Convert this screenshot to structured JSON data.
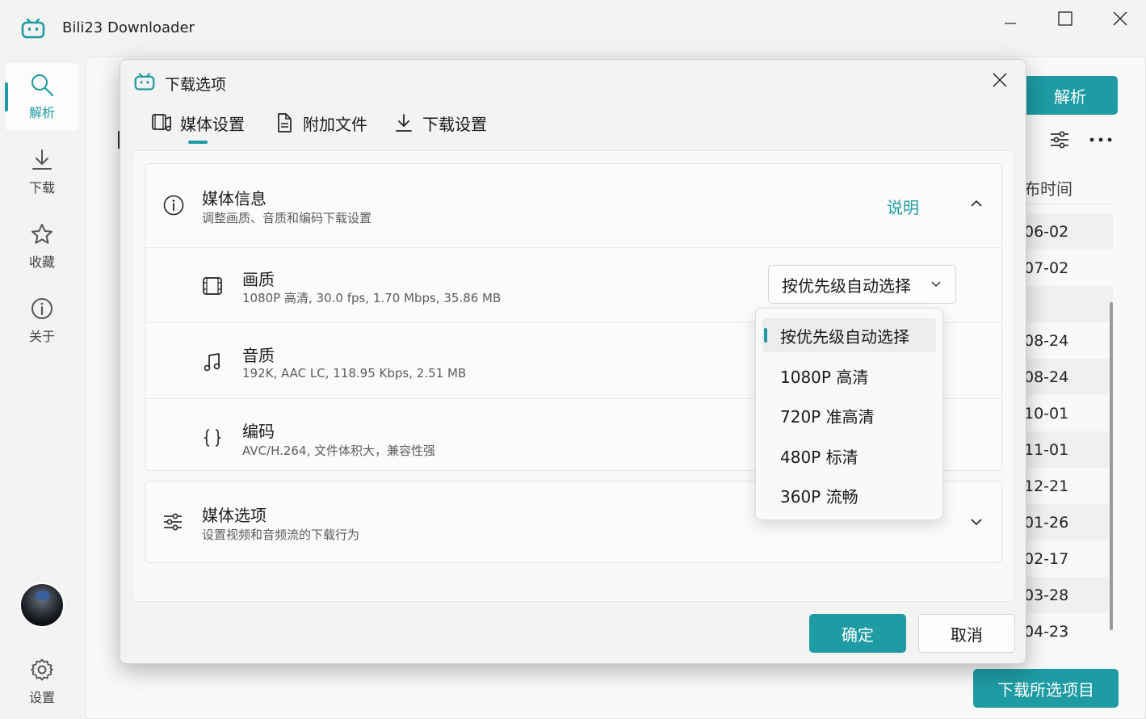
{
  "window": {
    "title": "Bili23 Downloader",
    "accent": "#1e9ba3"
  },
  "sidebar": {
    "items": [
      {
        "label": "解析",
        "icon": "search-icon"
      },
      {
        "label": "下载",
        "icon": "download-icon"
      },
      {
        "label": "收藏",
        "icon": "star-icon"
      },
      {
        "label": "关于",
        "icon": "info-icon"
      }
    ],
    "settings_label": "设置"
  },
  "background": {
    "parse_button": "解析",
    "column_header": "布时间",
    "rows": [
      "06-02",
      "07-02",
      "",
      "08-24",
      "08-24",
      "10-01",
      "11-01",
      "12-21",
      "01-26",
      "02-17",
      "03-28",
      "04-23"
    ],
    "download_selected_button": "下载所选项目"
  },
  "dialog": {
    "title": "下载选项",
    "tabs": [
      {
        "label": "媒体设置",
        "icon": "media-settings-icon",
        "active": true
      },
      {
        "label": "附加文件",
        "icon": "document-icon",
        "active": false
      },
      {
        "label": "下载设置",
        "icon": "download-icon",
        "active": false
      }
    ],
    "media_info": {
      "title": "媒体信息",
      "desc": "调整画质、音质和编码下载设置",
      "link": "说明"
    },
    "quality": {
      "title": "画质",
      "desc": "1080P 高清, 30.0 fps, 1.70 Mbps, 35.86 MB",
      "selected": "按优先级自动选择"
    },
    "audio": {
      "title": "音质",
      "desc": "192K, AAC LC, 118.95 Kbps, 2.51 MB"
    },
    "codec": {
      "title": "编码",
      "desc": "AVC/H.264, 文件体积大，兼容性强"
    },
    "media_options": {
      "title": "媒体选项",
      "desc": "设置视频和音频流的下载行为"
    },
    "ok_button": "确定",
    "cancel_button": "取消"
  },
  "dropdown": {
    "options": [
      "按优先级自动选择",
      "1080P 高清",
      "720P 准高清",
      "480P 标清",
      "360P 流畅"
    ]
  }
}
